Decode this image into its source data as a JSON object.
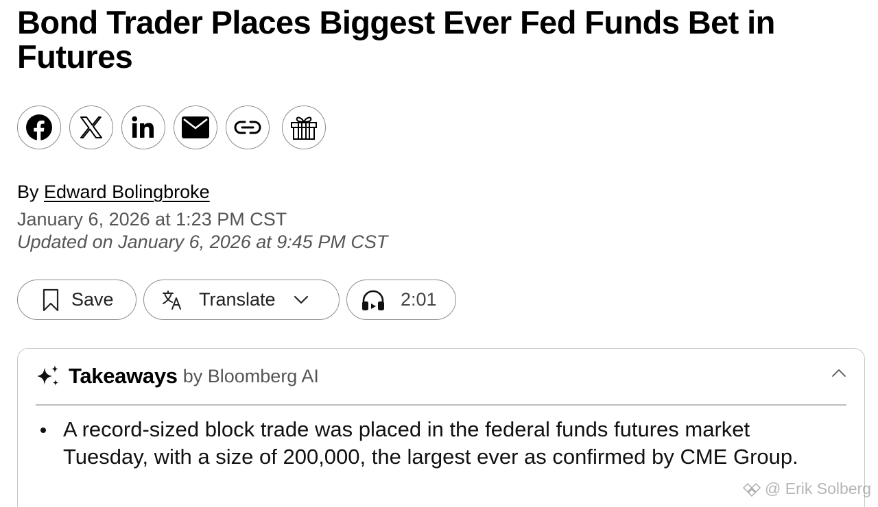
{
  "article": {
    "headline": "Bond Trader Places Biggest Ever Fed Funds Bet in Futures",
    "byline_prefix": "By",
    "author": "Edward Bolingbroke",
    "published": "January 6, 2026 at 1:23 PM CST",
    "updated": "Updated on January 6, 2026 at 9:45 PM CST"
  },
  "share": {
    "icons": [
      "facebook-icon",
      "x-icon",
      "linkedin-icon",
      "email-icon",
      "link-icon",
      "gift-icon"
    ]
  },
  "actions": {
    "save_label": "Save",
    "translate_label": "Translate",
    "listen_duration": "2:01"
  },
  "takeaways": {
    "title": "Takeaways",
    "by": "by Bloomberg AI",
    "items": [
      "A record-sized block trade was placed in the federal funds futures market Tuesday, with a size of 200,000, the largest ever as confirmed by CME Group."
    ]
  },
  "watermark": "@ Erik Solberg",
  "colors": {
    "text": "#000000",
    "muted": "#555555",
    "border": "#8c8c8c"
  }
}
